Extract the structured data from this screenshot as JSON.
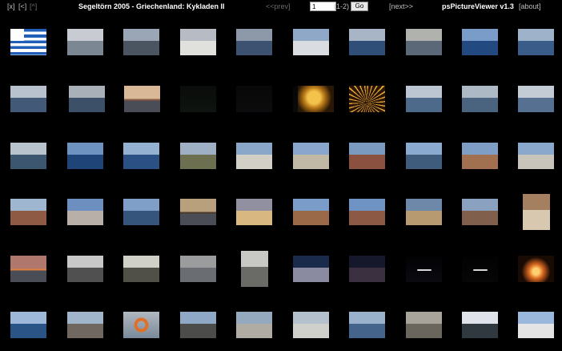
{
  "toolbar": {
    "close_label": "[x]",
    "back_label": "[<]",
    "up_label": "[^]",
    "title": "Segeltörn 2005 - Griechenland: Kykladen II",
    "prev_label": "<<prev]",
    "page_value": "1",
    "page_range": "(1-2)",
    "go_label": "Go",
    "next_label": "[next>>",
    "app_name": "psPictureViewer v1.3",
    "about_label": "[about]"
  },
  "thumbnails": [
    {
      "row": 0,
      "col": 0,
      "kind": "flag"
    },
    {
      "row": 0,
      "col": 1,
      "kind": "sail",
      "colors": [
        "#c8ccd2",
        "#7c8794"
      ]
    },
    {
      "row": 0,
      "col": 2,
      "kind": "deck",
      "colors": [
        "#9aa6b6",
        "#4b5562"
      ]
    },
    {
      "row": 0,
      "col": 3,
      "kind": "hazy",
      "colors": [
        "#b7bcc4",
        "#e0e0dc"
      ]
    },
    {
      "row": 0,
      "col": 4,
      "kind": "sea",
      "colors": [
        "#8d98a8",
        "#3d5270"
      ]
    },
    {
      "row": 0,
      "col": 5,
      "kind": "boat",
      "colors": [
        "#90a8c8",
        "#d9dde2"
      ]
    },
    {
      "row": 0,
      "col": 6,
      "kind": "boat",
      "colors": [
        "#a7b5c7",
        "#2f4f78"
      ]
    },
    {
      "row": 0,
      "col": 7,
      "kind": "sea",
      "colors": [
        "#b0b2ae",
        "#5a6878"
      ]
    },
    {
      "row": 0,
      "col": 8,
      "kind": "boat",
      "colors": [
        "#7a9cc8",
        "#234a80"
      ]
    },
    {
      "row": 0,
      "col": 9,
      "kind": "sail",
      "colors": [
        "#9eb2c9",
        "#3a5c88"
      ]
    },
    {
      "row": 1,
      "col": 0,
      "kind": "sea",
      "colors": [
        "#b8c2cf",
        "#425a78"
      ]
    },
    {
      "row": 1,
      "col": 1,
      "kind": "ship",
      "colors": [
        "#a9b0b8",
        "#3c5068"
      ]
    },
    {
      "row": 1,
      "col": 2,
      "kind": "sunset",
      "colors": [
        "#d8b896",
        "#8a5a42"
      ]
    },
    {
      "row": 1,
      "col": 3,
      "kind": "dark",
      "colors": [
        "#0a0c0a",
        "#0e1410"
      ]
    },
    {
      "row": 1,
      "col": 4,
      "kind": "dark",
      "colors": [
        "#080808",
        "#0c0c0e"
      ]
    },
    {
      "row": 1,
      "col": 5,
      "kind": "dark",
      "colors": [
        "#060606",
        "#0a0a0a"
      ]
    },
    {
      "row": 1,
      "col": 6,
      "kind": "lantern",
      "colors": [
        "#d89a24",
        "#3a2408"
      ]
    },
    {
      "row": 1,
      "col": 7,
      "kind": "firework",
      "colors": [
        "#c88420",
        "#2a1606"
      ]
    },
    {
      "row": 1,
      "col": 8,
      "kind": "sea",
      "colors": [
        "#bcc6d2",
        "#4e6a8a"
      ]
    },
    {
      "row": 1,
      "col": 9,
      "kind": "sea",
      "colors": [
        "#aeb9c6",
        "#4a6480"
      ]
    },
    {
      "row": 1,
      "col": 10,
      "kind": "sea",
      "colors": [
        "#c3ccd5",
        "#557090"
      ]
    },
    {
      "row": 2,
      "col": 0,
      "kind": "coast",
      "colors": [
        "#b9c3ce",
        "#3d5670"
      ]
    },
    {
      "row": 2,
      "col": 1,
      "kind": "sea",
      "colors": [
        "#6f93c0",
        "#1f4578"
      ]
    },
    {
      "row": 2,
      "col": 2,
      "kind": "deck",
      "colors": [
        "#94b1d2",
        "#2b5084"
      ]
    },
    {
      "row": 2,
      "col": 3,
      "kind": "coast",
      "colors": [
        "#9fb0c4",
        "#6c7050"
      ]
    },
    {
      "row": 2,
      "col": 4,
      "kind": "cliff",
      "colors": [
        "#8aa6c8",
        "#d2cfc6"
      ]
    },
    {
      "row": 2,
      "col": 5,
      "kind": "cliff",
      "colors": [
        "#8aa6cc",
        "#c2b8a6"
      ]
    },
    {
      "row": 2,
      "col": 6,
      "kind": "cliff",
      "colors": [
        "#7a9ac0",
        "#8a5040"
      ]
    },
    {
      "row": 2,
      "col": 7,
      "kind": "coast",
      "colors": [
        "#8aaad0",
        "#3f5c7c"
      ]
    },
    {
      "row": 2,
      "col": 8,
      "kind": "town",
      "colors": [
        "#7e9ec6",
        "#a07050"
      ]
    },
    {
      "row": 2,
      "col": 9,
      "kind": "town",
      "colors": [
        "#8aa8cc",
        "#c8c4bc"
      ]
    },
    {
      "row": 3,
      "col": 0,
      "kind": "cliff",
      "colors": [
        "#9fb6d0",
        "#8e5a44"
      ]
    },
    {
      "row": 3,
      "col": 1,
      "kind": "town",
      "colors": [
        "#6d8fc0",
        "#b8b0a8"
      ]
    },
    {
      "row": 3,
      "col": 2,
      "kind": "coast",
      "colors": [
        "#7f9ec8",
        "#35557c"
      ]
    },
    {
      "row": 3,
      "col": 3,
      "kind": "sunset",
      "colors": [
        "#b8a07c",
        "#4a3a2a"
      ]
    },
    {
      "row": 3,
      "col": 4,
      "kind": "dusk",
      "colors": [
        "#9090a0",
        "#d8b880"
      ]
    },
    {
      "row": 3,
      "col": 5,
      "kind": "town",
      "colors": [
        "#7a9cc8",
        "#9a6a48"
      ]
    },
    {
      "row": 3,
      "col": 6,
      "kind": "town",
      "colors": [
        "#6f94c4",
        "#8c5a44"
      ]
    },
    {
      "row": 3,
      "col": 7,
      "kind": "town",
      "colors": [
        "#6d88a8",
        "#b89a70"
      ]
    },
    {
      "row": 3,
      "col": 8,
      "kind": "cliff",
      "colors": [
        "#8aa2c0",
        "#80604c"
      ]
    },
    {
      "row": 3,
      "col": 9,
      "kind": "portrait-town",
      "colors": [
        "#a48060",
        "#d8c8b0"
      ]
    },
    {
      "row": 4,
      "col": 0,
      "kind": "sunset",
      "colors": [
        "#b0786c",
        "#e08040"
      ]
    },
    {
      "row": 4,
      "col": 1,
      "kind": "harbor",
      "colors": [
        "#c8c8c8",
        "#505050"
      ]
    },
    {
      "row": 4,
      "col": 2,
      "kind": "cabin",
      "colors": [
        "#d0d0c8",
        "#505048"
      ]
    },
    {
      "row": 4,
      "col": 3,
      "kind": "grey",
      "colors": [
        "#9a9c9e",
        "#6a6e72"
      ]
    },
    {
      "row": 4,
      "col": 4,
      "kind": "portrait-grey",
      "colors": [
        "#c8c8c4",
        "#6a6a66"
      ]
    },
    {
      "row": 4,
      "col": 5,
      "kind": "nighttown",
      "colors": [
        "#1a2a4a",
        "#8a8aa0"
      ]
    },
    {
      "row": 4,
      "col": 6,
      "kind": "dusk2",
      "colors": [
        "#14182a",
        "#3a3040"
      ]
    },
    {
      "row": 4,
      "col": 7,
      "kind": "nightlight",
      "colors": [
        "#020204",
        "#0a0a10"
      ]
    },
    {
      "row": 4,
      "col": 8,
      "kind": "nightlights",
      "colors": [
        "#020202",
        "#060606"
      ]
    },
    {
      "row": 4,
      "col": 9,
      "kind": "lamp",
      "colors": [
        "#0c0604",
        "#d86820"
      ]
    },
    {
      "row": 5,
      "col": 0,
      "kind": "sea",
      "colors": [
        "#9db8d8",
        "#2a5486"
      ]
    },
    {
      "row": 5,
      "col": 1,
      "kind": "cliff",
      "colors": [
        "#a0b4ca",
        "#706860"
      ]
    },
    {
      "row": 5,
      "col": 2,
      "kind": "lifebuoy",
      "colors": [
        "#b0b8c0",
        "#d86a28"
      ]
    },
    {
      "row": 5,
      "col": 3,
      "kind": "coast",
      "colors": [
        "#8ea8c6",
        "#4c4c4a"
      ]
    },
    {
      "row": 5,
      "col": 4,
      "kind": "cliff",
      "colors": [
        "#94a8be",
        "#b0aca4"
      ]
    },
    {
      "row": 5,
      "col": 5,
      "kind": "town",
      "colors": [
        "#b4c0cc",
        "#cfcfcc"
      ]
    },
    {
      "row": 5,
      "col": 6,
      "kind": "sea",
      "colors": [
        "#9ab2cc",
        "#44648c"
      ]
    },
    {
      "row": 5,
      "col": 7,
      "kind": "grey",
      "colors": [
        "#a8a49c",
        "#6a665e"
      ]
    },
    {
      "row": 5,
      "col": 8,
      "kind": "sailcloud",
      "colors": [
        "#e0e4ea",
        "#303840"
      ]
    },
    {
      "row": 5,
      "col": 9,
      "kind": "town",
      "colors": [
        "#9ab8dc",
        "#e4e4e4"
      ]
    }
  ]
}
